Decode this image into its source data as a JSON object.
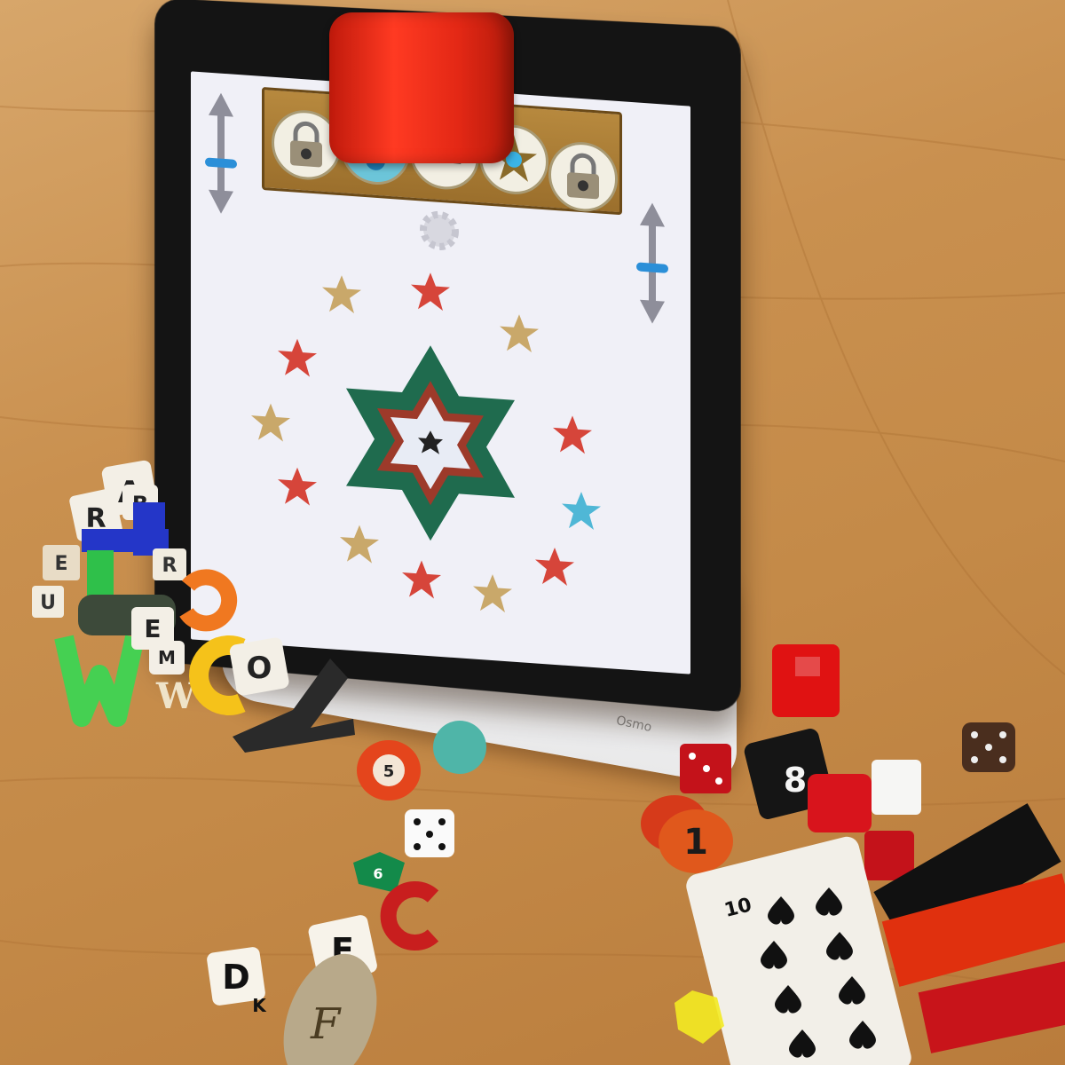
{
  "scene": {
    "dock_brand": "Osmo",
    "panel_dial_number": "12"
  },
  "letters": {
    "cube_A": "A",
    "cube_R": "R",
    "cube_B": "B",
    "tile_U": "U",
    "tile_E": "E",
    "tile_R": "R",
    "cube_E": "E",
    "cube_M": "M",
    "cube_O": "O",
    "small_W": "W",
    "cube_D": "D",
    "cube_E2": "E",
    "cube_K": "K",
    "oval_F": "F"
  },
  "pieces": {
    "checker_5": "5",
    "checker_1": "1",
    "tile_8": "8",
    "card_rank": "10",
    "d8_number": "6"
  },
  "colors": {
    "accent_red": "#e32815",
    "table": "#c9904f"
  }
}
